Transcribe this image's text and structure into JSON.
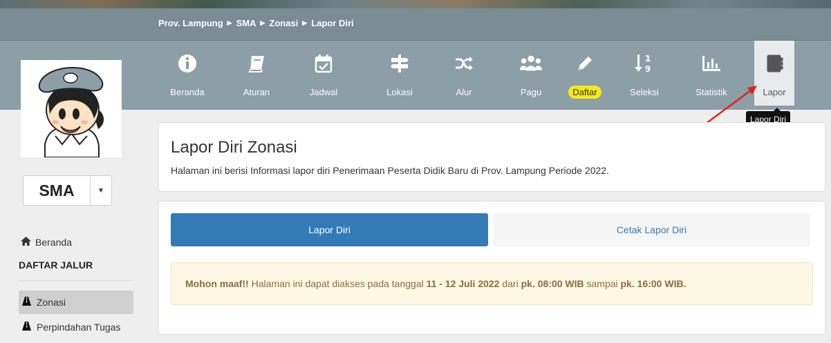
{
  "breadcrumb": [
    "Prov. Lampung",
    "SMA",
    "Zonasi",
    "Lapor Diri"
  ],
  "nav": [
    {
      "label": "Beranda",
      "icon": "info-icon"
    },
    {
      "label": "Aturan",
      "icon": "book-icon"
    },
    {
      "label": "Jadwal",
      "icon": "calendar-check-icon"
    },
    {
      "label": "Lokasi",
      "icon": "signpost-icon"
    },
    {
      "label": "Alur",
      "icon": "shuffle-icon"
    },
    {
      "label": "Pagu",
      "icon": "users-icon"
    },
    {
      "label": "Daftar",
      "icon": "pencil-icon"
    },
    {
      "label": "Seleksi",
      "icon": "sort-numeric-icon"
    },
    {
      "label": "Statistik",
      "icon": "bar-chart-icon"
    },
    {
      "label": "Lapor",
      "icon": "contact-book-icon"
    }
  ],
  "tooltip": "Lapor Diri",
  "sidebar": {
    "level": "SMA",
    "home": "Beranda",
    "heading": "DAFTAR JALUR",
    "items": [
      "Zonasi",
      "Perpindahan Tugas"
    ]
  },
  "main": {
    "title": "Lapor Diri Zonasi",
    "description": "Halaman ini berisi Informasi lapor diri Penerimaan Peserta Didik Baru di Prov. Lampung Periode 2022.",
    "tabs": [
      "Lapor Diri",
      "Cetak Lapor Diri"
    ],
    "alert": {
      "lead": "Mohon maaf!!",
      "text1": " Halaman ini dapat diakses pada tanggal ",
      "dates": "11 - 12 Juli 2022",
      "text2": " dari ",
      "time1": "pk. 08:00 WIB",
      "text3": " sampai ",
      "time2": "pk. 16:00 WIB."
    }
  },
  "colors": {
    "primary": "#337ab7",
    "badge": "#f5ea1d",
    "alert_bg": "#fcf8e3",
    "topbar": "#8c9ea6"
  }
}
